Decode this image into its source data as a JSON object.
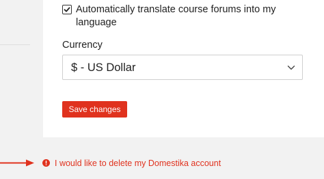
{
  "settings": {
    "translate_checkbox": {
      "checked": true,
      "label": "Automatically translate course forums into my language"
    },
    "currency": {
      "label": "Currency",
      "selected_value": "$ - US Dollar"
    },
    "save_label": "Save changes"
  },
  "footer": {
    "delete_account_label": "I would like to delete my Domestika account"
  },
  "colors": {
    "accent": "#e0321e",
    "background": "#f2f2f2",
    "card": "#ffffff",
    "text": "#222222"
  },
  "icons": {
    "checkbox_mark": "check-icon",
    "select_arrow": "chevron-down-icon",
    "warning": "alert-circle-icon",
    "pointer": "arrow-right-icon"
  }
}
